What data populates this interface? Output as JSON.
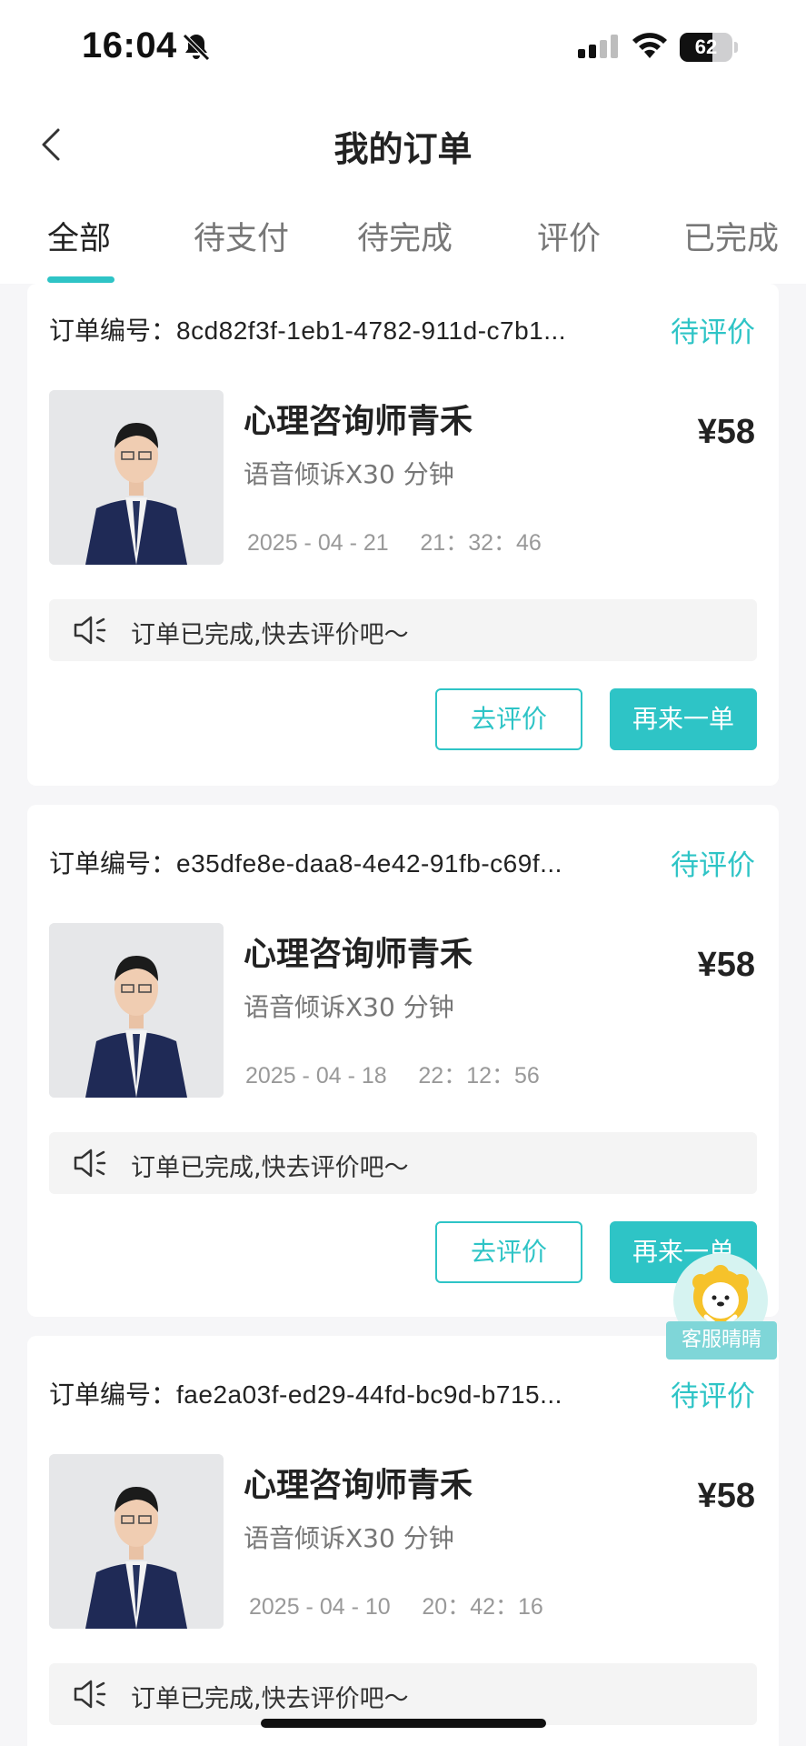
{
  "status_bar": {
    "time": "16:04",
    "battery": "62",
    "battery_level": 0.62,
    "icons": [
      "bell-slash-icon",
      "signal-icon",
      "wifi-icon",
      "battery-icon"
    ]
  },
  "nav": {
    "title": "我的订单",
    "back_icon": "chevron-left-icon"
  },
  "tabs": [
    {
      "label": "全部",
      "active": true
    },
    {
      "label": "待支付",
      "active": false
    },
    {
      "label": "待完成",
      "active": false
    },
    {
      "label": "评价",
      "active": false
    },
    {
      "label": "已完成",
      "active": false
    }
  ],
  "order_no_label": "订单编号：",
  "orders": [
    {
      "order_no": "8cd82f3f-1eb1-4782-911d-c7b1...",
      "status": "待评价",
      "title": "心理咨询师青禾",
      "desc": "语音倾诉X30 分钟",
      "datetime": "2025 - 04 - 21     21：32：46",
      "price": "¥58",
      "notice": "订单已完成,快去评价吧～",
      "review_btn": "去评价",
      "again_btn": "再来一单"
    },
    {
      "order_no": "e35dfe8e-daa8-4e42-91fb-c69f...",
      "status": "待评价",
      "title": "心理咨询师青禾",
      "desc": "语音倾诉X30 分钟",
      "datetime": "2025 - 04 - 18     22：12：56",
      "price": "¥58",
      "notice": "订单已完成,快去评价吧～",
      "review_btn": "去评价",
      "again_btn": "再来一单"
    },
    {
      "order_no": "fae2a03f-ed29-44fd-bc9d-b715...",
      "status": "待评价",
      "title": "心理咨询师青禾",
      "desc": "语音倾诉X30 分钟",
      "datetime": "2025 - 04 - 10     20：42：16",
      "price": "¥58",
      "notice": "订单已完成,快去评价吧～"
    }
  ],
  "customer_service": {
    "label": "客服晴晴"
  },
  "colors": {
    "accent": "#2ec4c6",
    "background": "#f6f6f8"
  }
}
